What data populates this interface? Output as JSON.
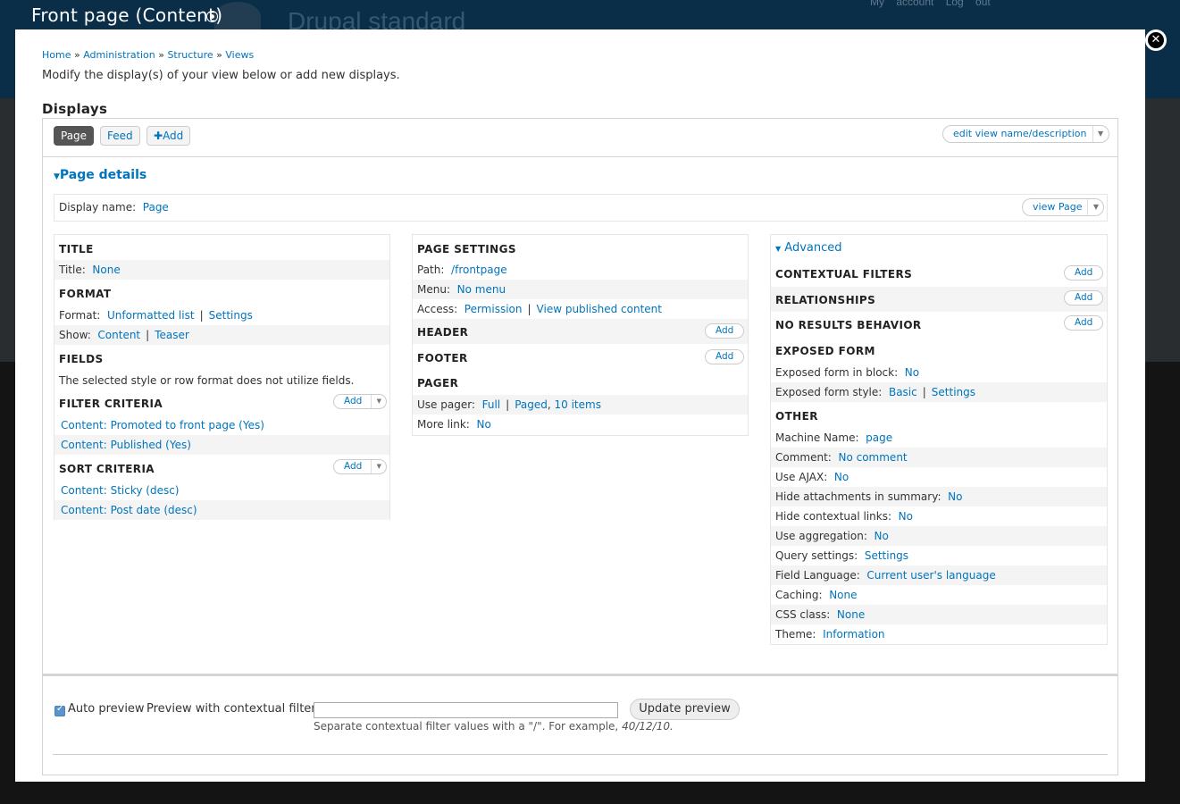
{
  "dialog_title": "Front page (Content)",
  "background": {
    "site_name": "Drupal standard",
    "account_links": "My account  Log out"
  },
  "breadcrumb": {
    "items": [
      "Home",
      "Administration",
      "Structure",
      "Views"
    ],
    "separator": "»"
  },
  "intro": "Modify the display(s) of your view below or add new displays.",
  "displays": {
    "heading": "Displays",
    "tabs": [
      "Page",
      "Feed"
    ],
    "add_label": "Add",
    "edit_view_label": "edit view name/description"
  },
  "page_details": {
    "toggle": "Page details",
    "display_name_label": "Display name:",
    "display_name_value": "Page",
    "view_page_label": "view Page"
  },
  "left": {
    "title_h": "TITLE",
    "title_label": "Title:",
    "title_value": "None",
    "format_h": "FORMAT",
    "format_label": "Format:",
    "format_value": "Unformatted list",
    "format_settings": "Settings",
    "show_label": "Show:",
    "show_value": "Content",
    "show_teaser": "Teaser",
    "fields_h": "FIELDS",
    "fields_note": "The selected style or row format does not utilize fields.",
    "filter_h": "FILTER CRITERIA",
    "filter_items": [
      "Content: Promoted to front page (Yes)",
      "Content: Published (Yes)"
    ],
    "sort_h": "SORT CRITERIA",
    "sort_items": [
      "Content: Sticky (desc)",
      "Content: Post date (desc)"
    ],
    "add": "Add"
  },
  "middle": {
    "page_settings_h": "PAGE SETTINGS",
    "path_label": "Path:",
    "path_value": "/frontpage",
    "menu_label": "Menu:",
    "menu_value": "No menu",
    "access_label": "Access:",
    "access_value": "Permission",
    "access_detail": "View published content",
    "header_h": "HEADER",
    "footer_h": "FOOTER",
    "add": "Add",
    "pager_h": "PAGER",
    "use_pager_label": "Use pager:",
    "use_pager_value": "Full",
    "pager_paged": "Paged",
    "pager_items": "10 items",
    "more_link_label": "More link:",
    "more_link_value": "No"
  },
  "right": {
    "advanced": "Advanced",
    "contextual_h": "CONTEXTUAL FILTERS",
    "relationships_h": "RELATIONSHIPS",
    "no_results_h": "NO RESULTS BEHAVIOR",
    "add": "Add",
    "exposed_h": "EXPOSED FORM",
    "exposed_block_label": "Exposed form in block:",
    "exposed_block_value": "No",
    "exposed_style_label": "Exposed form style:",
    "exposed_style_value": "Basic",
    "exposed_style_settings": "Settings",
    "other_h": "OTHER",
    "other_rows": [
      {
        "label": "Machine Name:",
        "value": "page"
      },
      {
        "label": "Comment:",
        "value": "No comment"
      },
      {
        "label": "Use AJAX:",
        "value": "No"
      },
      {
        "label": "Hide attachments in summary:",
        "value": "No"
      },
      {
        "label": "Hide contextual links:",
        "value": "No"
      },
      {
        "label": "Use aggregation:",
        "value": "No"
      },
      {
        "label": "Query settings:",
        "value": "Settings"
      },
      {
        "label": "Field Language:",
        "value": "Current user's language"
      },
      {
        "label": "Caching:",
        "value": "None"
      },
      {
        "label": "CSS class:",
        "value": "None"
      },
      {
        "label": "Theme:",
        "value": "Information"
      }
    ]
  },
  "preview": {
    "auto_preview_label": "Auto preview",
    "auto_preview_checked": true,
    "contextual_label": "Preview with contextual filters:",
    "contextual_value": "",
    "update_label": "Update preview",
    "hint": "Separate contextual filter values with a \"/\". For example,",
    "hint_example": "40/12/10."
  }
}
